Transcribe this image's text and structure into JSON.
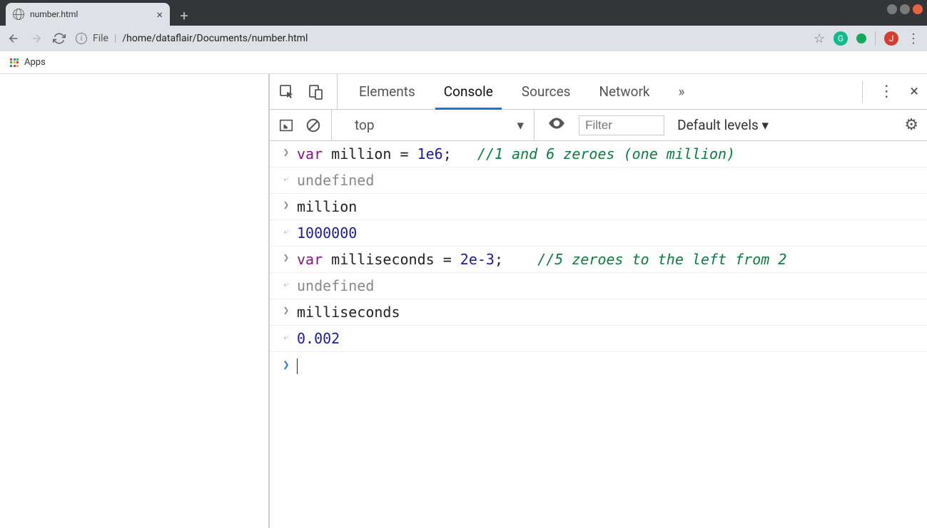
{
  "tab": {
    "title": "number.html"
  },
  "address": {
    "file_label": "File",
    "url": "/home/dataflair/Documents/number.html"
  },
  "bookmarks": {
    "apps": "Apps"
  },
  "devtools": {
    "tabs": {
      "elements": "Elements",
      "console": "Console",
      "sources": "Sources",
      "network": "Network"
    },
    "toolbar": {
      "context": "top",
      "filter_placeholder": "Filter",
      "levels": "Default levels ▾"
    }
  },
  "console": [
    {
      "type": "input",
      "segments": [
        {
          "t": "kw",
          "v": "var"
        },
        {
          "t": "txt",
          "v": " million = "
        },
        {
          "t": "num",
          "v": "1e6"
        },
        {
          "t": "txt",
          "v": ";   "
        },
        {
          "t": "comment",
          "v": "//1 and 6 zeroes (one million)"
        }
      ]
    },
    {
      "type": "output",
      "segments": [
        {
          "t": "undef",
          "v": "undefined"
        }
      ]
    },
    {
      "type": "input",
      "segments": [
        {
          "t": "txt",
          "v": "million"
        }
      ]
    },
    {
      "type": "output",
      "segments": [
        {
          "t": "num",
          "v": "1000000"
        }
      ]
    },
    {
      "type": "input",
      "segments": [
        {
          "t": "kw",
          "v": "var"
        },
        {
          "t": "txt",
          "v": " milliseconds = "
        },
        {
          "t": "num",
          "v": "2e-3"
        },
        {
          "t": "txt",
          "v": ";    "
        },
        {
          "t": "comment",
          "v": "//5 zeroes to the left from 2"
        }
      ]
    },
    {
      "type": "output",
      "segments": [
        {
          "t": "undef",
          "v": "undefined"
        }
      ]
    },
    {
      "type": "input",
      "segments": [
        {
          "t": "txt",
          "v": "milliseconds"
        }
      ]
    },
    {
      "type": "output",
      "segments": [
        {
          "t": "num",
          "v": "0.002"
        }
      ]
    }
  ]
}
